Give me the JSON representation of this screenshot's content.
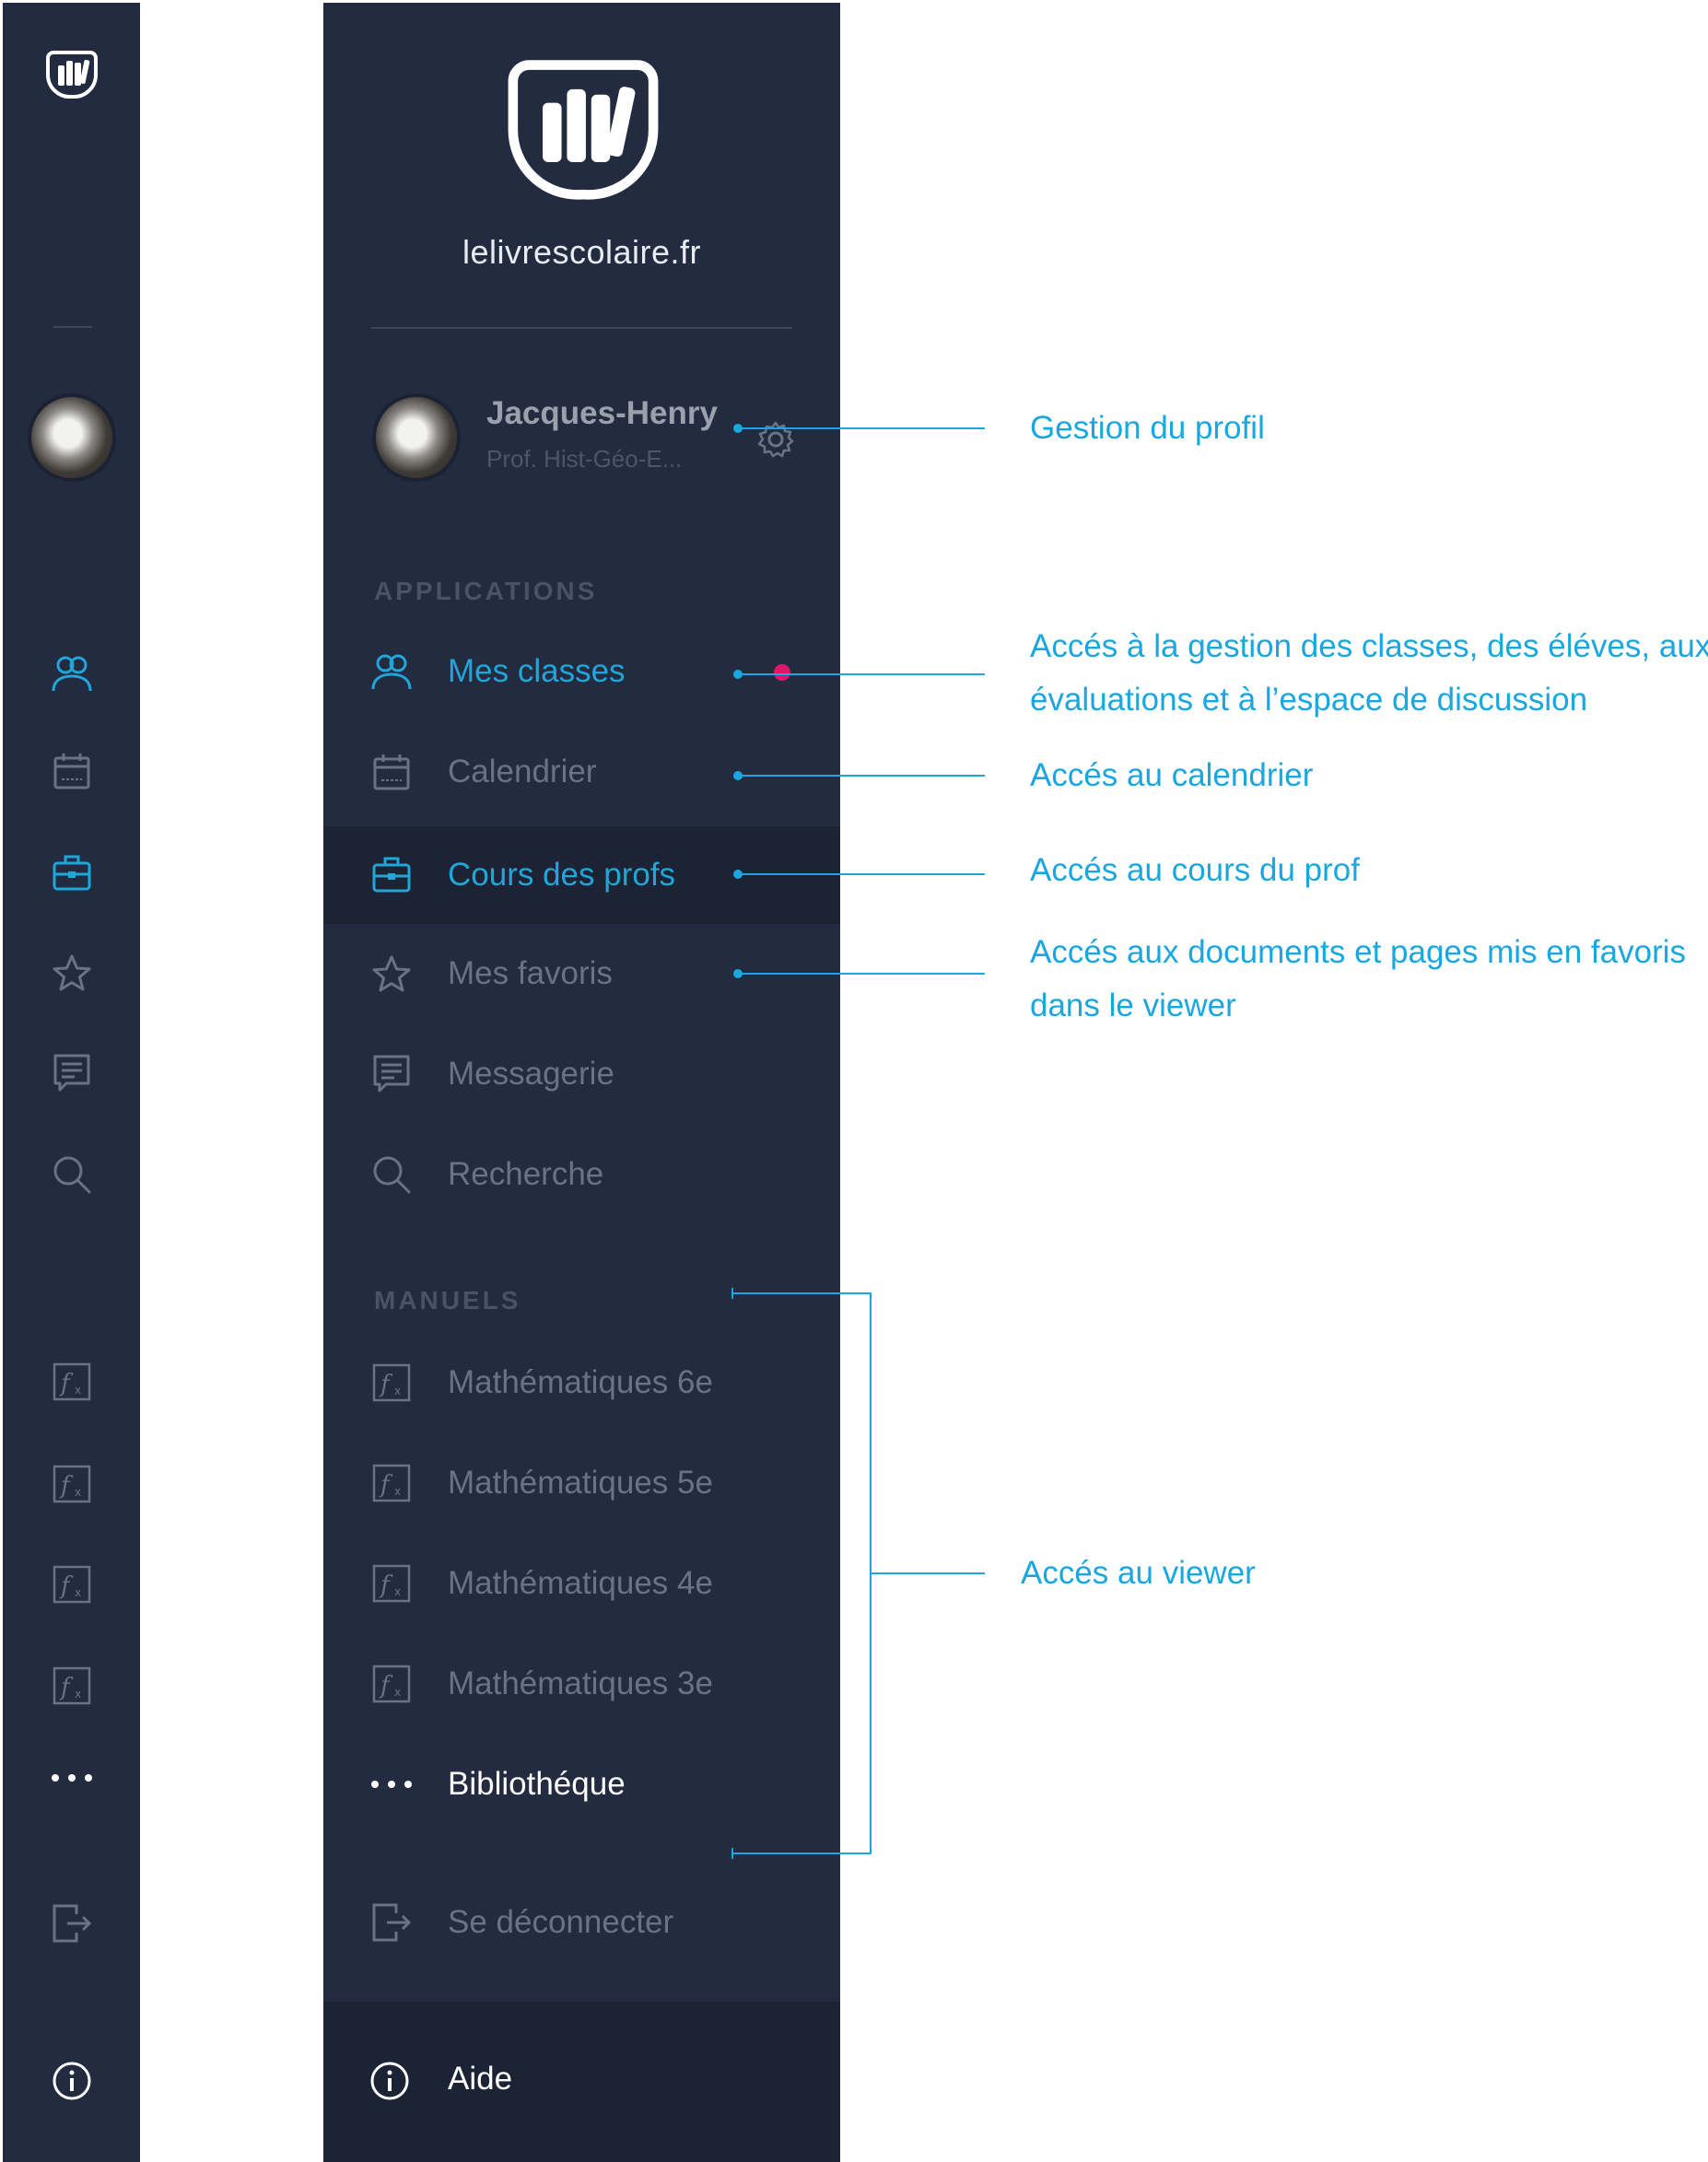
{
  "colors": {
    "panel": "#222b3f",
    "panel_dark": "#1b2334",
    "accent": "#20a6d8",
    "muted": "#6a7383",
    "notification": "#e2136b",
    "annotation": "#1aa7df"
  },
  "brand": {
    "name": "lelivrescolaire.fr",
    "logo_icon": "books-logo-icon"
  },
  "profile": {
    "name": "Jacques-Henry",
    "role": "Prof. Hist-Géo-E...",
    "settings_icon": "gear-icon"
  },
  "sections": {
    "applications": "APPLICATIONS",
    "manuels": "MANUELS"
  },
  "nav": [
    {
      "id": "classes",
      "label": "Mes classes",
      "icon": "users-icon",
      "state": "active",
      "notification": true
    },
    {
      "id": "calendar",
      "label": "Calendrier",
      "icon": "calendar-icon",
      "state": "default"
    },
    {
      "id": "courses",
      "label": "Cours des profs",
      "icon": "briefcase-icon",
      "state": "selected"
    },
    {
      "id": "favorites",
      "label": "Mes favoris",
      "icon": "star-icon",
      "state": "default"
    },
    {
      "id": "messages",
      "label": "Messagerie",
      "icon": "message-icon",
      "state": "default"
    },
    {
      "id": "search",
      "label": "Recherche",
      "icon": "search-icon",
      "state": "default"
    }
  ],
  "manuals": [
    {
      "label": "Mathématiques 6e",
      "icon": "function-icon"
    },
    {
      "label": "Mathématiques 5e",
      "icon": "function-icon"
    },
    {
      "label": "Mathématiques 4e",
      "icon": "function-icon"
    },
    {
      "label": "Mathématiques 3e",
      "icon": "function-icon"
    }
  ],
  "library": {
    "label": "Bibliothéque",
    "icon": "more-dots-icon"
  },
  "logout": {
    "label": "Se déconnecter",
    "icon": "logout-icon"
  },
  "help": {
    "label": "Aide",
    "icon": "info-icon"
  },
  "annotations": {
    "profile": "Gestion du profil",
    "classes_line1": "Accés à la gestion des classes, des éléves, aux",
    "classes_line2": "évaluations et à l’espace de discussion",
    "calendar": "Accés au calendrier",
    "courses": "Accés au cours du prof",
    "favorites_line1": "Accés aux documents et pages mis en favoris",
    "favorites_line2": "dans le viewer",
    "viewer": "Accés au viewer"
  }
}
